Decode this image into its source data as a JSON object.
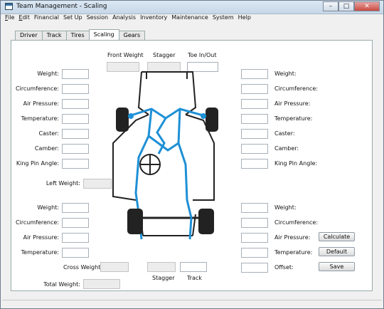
{
  "window": {
    "title": "Team Management - Scaling",
    "btn_min": "–",
    "btn_max": "□",
    "btn_close": "✕"
  },
  "menu": [
    "File",
    "Edit",
    "Financial",
    "Set Up",
    "Session",
    "Analysis",
    "Inventory",
    "Maintenance",
    "System",
    "Help"
  ],
  "tabs": [
    "Driver",
    "Track",
    "Tires",
    "Scaling",
    "Gears"
  ],
  "active_tab": "Scaling",
  "center_headers": {
    "front_weight": "Front Weight",
    "stagger": "Stagger",
    "toe": "Toe In/Out"
  },
  "left_front": {
    "weight": "Weight:",
    "circumference": "Circumference:",
    "air_pressure": "Air Pressure:",
    "temperature": "Temperature:",
    "caster": "Caster:",
    "camber": "Camber:",
    "king_pin": "King Pin Angle:"
  },
  "right_front": {
    "weight": "Weight:",
    "circumference": "Circumference:",
    "air_pressure": "Air Pressure:",
    "temperature": "Temperature:",
    "caster": "Caster:",
    "camber": "Camber:",
    "king_pin": "King Pin Angle:"
  },
  "left_weight_label": "Left Weight:",
  "left_rear": {
    "weight": "Weight:",
    "circumference": "Circumference:",
    "air_pressure": "Air Pressure:",
    "temperature": "Temperature:"
  },
  "right_rear": {
    "weight": "Weight:",
    "circumference": "Circumference:",
    "air_pressure": "Air Pressure:",
    "temperature": "Temperature:",
    "offset": "Offset:"
  },
  "bottom": {
    "cross_weight": "Cross Weight",
    "stagger": "Stagger",
    "track": "Track",
    "total_weight": "Total Weight:"
  },
  "buttons": {
    "calculate": "Calculate",
    "default": "Default",
    "save": "Save"
  },
  "colors": {
    "chassis_blue": "#1e90d6",
    "frame_dark": "#222222"
  }
}
